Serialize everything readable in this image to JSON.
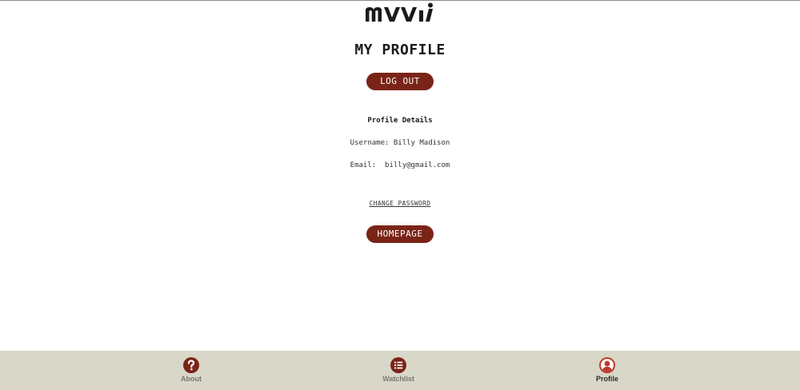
{
  "app": {
    "logo_text": "mvvi"
  },
  "page": {
    "title": "MY PROFILE"
  },
  "actions": {
    "logout_label": "LOG OUT",
    "homepage_label": "HOMEPAGE",
    "change_password_label": "CHANGE PASSWORD"
  },
  "profile": {
    "heading": "Profile Details",
    "username_label": "Username:",
    "username_value": "Billy Madison",
    "email_label": "Email:",
    "email_value": "billy@gmail.com"
  },
  "nav": {
    "items": [
      {
        "label": "About",
        "icon": "question-circle-icon",
        "active": false
      },
      {
        "label": "Watchlist",
        "icon": "list-circle-icon",
        "active": false
      },
      {
        "label": "Profile",
        "icon": "user-circle-icon",
        "active": true
      }
    ]
  },
  "colors": {
    "accent": "#7a2418",
    "nav_background": "#d9d7c8",
    "active_icon": "#c0392b"
  }
}
